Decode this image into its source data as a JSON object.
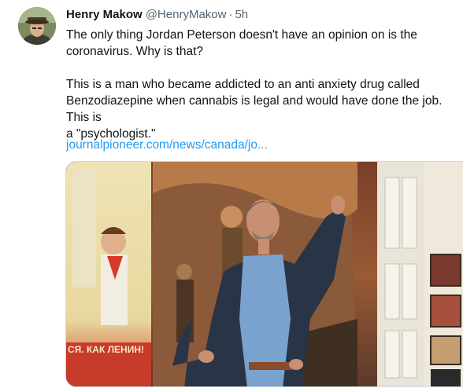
{
  "tweet": {
    "author_name": "Henry Makow",
    "author_handle": "@HenryMakow",
    "separator": "·",
    "time": "5h",
    "paragraph_1": "The only thing Jordan Peterson doesn't have an opinion on is the\ncoronavirus. Why is that?",
    "paragraph_2": "This is a man who became addicted to an anti anxiety drug called\nBenzodiazepine when cannabis is legal and would have done the job. This is\na \"psychologist.\"",
    "link_text": "journalpioneer.com/news/canada/jo..."
  },
  "media": {
    "poster_caption": "СЯ. КАК ЛЕНИН!"
  },
  "colors": {
    "link": "#1d9bf0",
    "secondary_text": "#536471",
    "primary_text": "#0f1419"
  }
}
